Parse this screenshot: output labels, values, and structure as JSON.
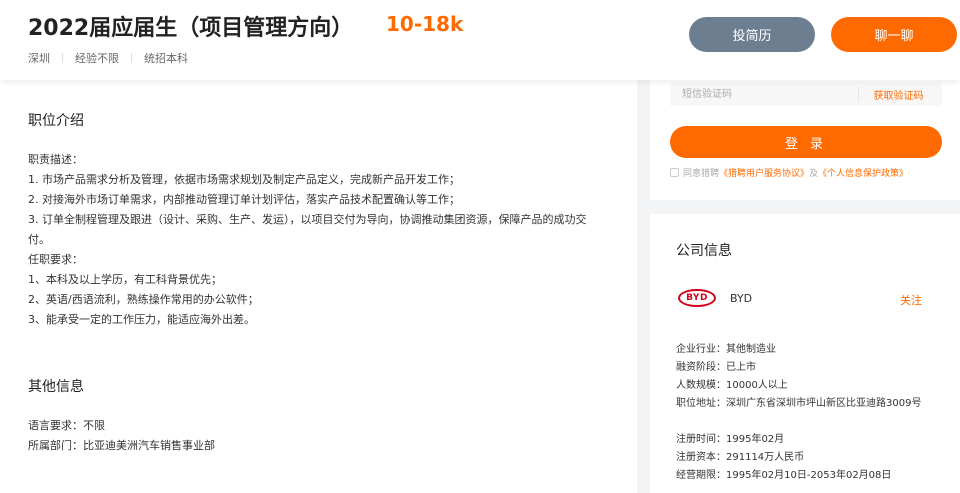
{
  "header": {
    "job_title": "2022届应届生（项目管理方向）",
    "salary": "10-18k",
    "location": "深圳",
    "experience": "经验不限",
    "education": "统招本科",
    "resume_button": "投简历",
    "chat_button": "聊一聊"
  },
  "main": {
    "intro_title": "职位介绍",
    "desc_lines": [
      "职责描述：",
      "1. 市场产品需求分析及管理，依据市场需求规划及制定产品定义，完成新产品开发工作；",
      "2. 对接海外市场订单需求，内部推动管理订单计划评估，落实产品技术配置确认等工作；",
      "3. 订单全制程管理及跟进（设计、采购、生产、发运），以项目交付为导向，协调推动集团资源，保障产品的成功交",
      "付。",
      "任职要求：",
      "1、本科及以上学历，有工科背景优先；",
      "2、英语/西语流利，熟练操作常用的办公软件；",
      "3、能承受一定的工作压力，能适应海外出差。"
    ],
    "other_title": "其他信息",
    "other_lines": [
      "语言要求：不限",
      "所属部门：比亚迪美洲汽车销售事业部"
    ]
  },
  "login": {
    "sms_placeholder": "短信验证码",
    "get_code": "获取验证码",
    "login_button": "登 录",
    "agree_prefix": "同意猎聘",
    "agree_link1": "《猎聘用户服务协议》",
    "agree_and": "及",
    "agree_link2": "《个人信息保护政策》"
  },
  "company": {
    "title": "公司信息",
    "logo_text": "BYD",
    "name": "BYD",
    "follow": "关注",
    "info_group1": [
      "企业行业：其他制造业",
      "融资阶段：已上市",
      "人数规模：10000人以上",
      "职位地址：深圳广东省深圳市坪山新区比亚迪路3009号"
    ],
    "info_group2": [
      "注册时间：1995年02月",
      "注册资本：291114万人民币",
      "经营期限：1995年02月10日-2053年02月08日"
    ]
  },
  "colors": {
    "accent": "#ff6a00",
    "resume_button": "#6e7e91",
    "logo_red": "#d0021b"
  }
}
